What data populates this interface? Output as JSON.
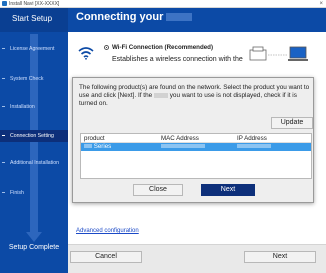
{
  "window": {
    "title": "Install Navi [XX-XXXX]",
    "close_glyph": "×"
  },
  "sidebar": {
    "header": "Start Setup",
    "steps": [
      {
        "label": "License Agreement"
      },
      {
        "label": "System Check"
      },
      {
        "label": "Installation"
      },
      {
        "label": "Connection Setting"
      },
      {
        "label": "Additional Installation"
      },
      {
        "label": "Finish"
      }
    ],
    "active_step": "Connection Setting",
    "footer": "Setup Complete"
  },
  "main": {
    "header": "Connecting your",
    "wifi_option": {
      "title": "Wi-Fi Connection (Recommended)",
      "description": "Establishes a wireless connection with the"
    },
    "advanced_link": "Advanced configuration",
    "footer": {
      "cancel_label": "Cancel",
      "next_label": "Next"
    }
  },
  "dialog": {
    "message_part1": "The following product(s) are found on the network. Select the product you want to use and click [Next]. If the",
    "message_part2": "you want to use is not displayed, check if it is turned on.",
    "update_label": "Update",
    "columns": [
      "product",
      "MAC Address",
      "IP Address"
    ],
    "rows": [
      {
        "product": "Series",
        "mac": "",
        "ip": ""
      }
    ],
    "close_label": "Close",
    "next_label": "Next"
  },
  "colors": {
    "sidebar": "#0c4aa6",
    "active_step": "#0d2f7a",
    "selected_row": "#3b9be8",
    "link": "#1a49c7"
  },
  "icons": [
    "wifi-icon",
    "printer-computer-diagram-icon",
    "app-icon",
    "close-icon"
  ]
}
